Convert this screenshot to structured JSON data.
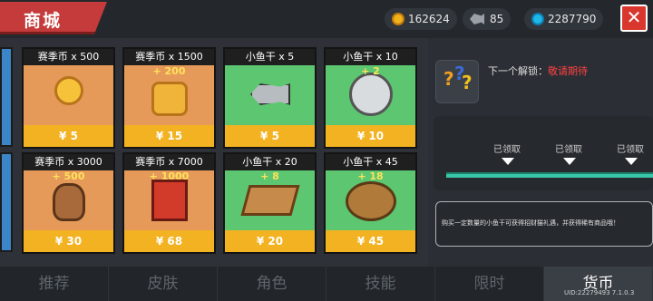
{
  "header": {
    "title": "商城",
    "gold": "162624",
    "fish": "85",
    "gems": "2287790",
    "close_icon": "close-x-icon"
  },
  "items": [
    {
      "name": "赛季币 x 500",
      "bonus": "",
      "price": "¥ 5",
      "icon": "season-coin-icon"
    },
    {
      "name": "赛季币 x 1500",
      "bonus": "+ 200",
      "price": "¥ 15",
      "icon": "coin-stack-icon"
    },
    {
      "name": "小鱼干 x 5",
      "bonus": "",
      "price": "¥ 5",
      "icon": "single-fish-icon"
    },
    {
      "name": "小鱼干 x 10",
      "bonus": "+ 2",
      "price": "¥ 10",
      "icon": "fish-plate-icon"
    },
    {
      "name": "赛季币 x 3000",
      "bonus": "+ 500",
      "price": "¥ 30",
      "icon": "coin-bag-icon"
    },
    {
      "name": "赛季币 x 7000",
      "bonus": "+ 1000",
      "price": "¥ 68",
      "icon": "coin-chest-icon"
    },
    {
      "name": "小鱼干 x 20",
      "bonus": "+ 8",
      "price": "¥ 20",
      "icon": "fish-tray-icon"
    },
    {
      "name": "小鱼干 x 45",
      "bonus": "+ 18",
      "price": "¥ 45",
      "icon": "fish-basket-icon"
    }
  ],
  "unlock": {
    "label": "下一个解锁：",
    "value": "敬请期待"
  },
  "milestones": [
    "已领取",
    "已领取",
    "已领取"
  ],
  "description": "购买一定数量的小鱼干可获得招财猫礼遇，并获得稀有商品哦！",
  "tabs": [
    "推荐",
    "皮肤",
    "角色",
    "技能",
    "限时",
    "货币"
  ],
  "uid": "UID:22279493 7.1.0.3"
}
